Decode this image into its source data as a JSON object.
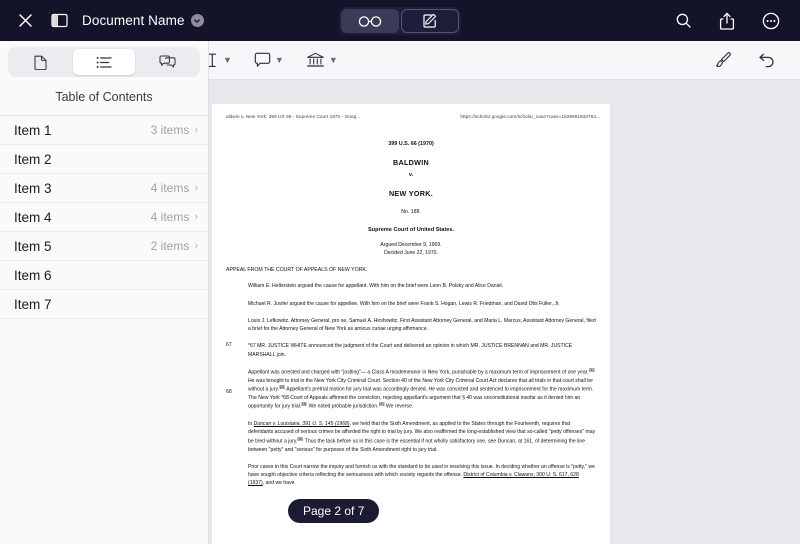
{
  "topbar": {
    "close_icon": "close-x-icon",
    "sidebar_toggle_icon": "sidebar-toggle-icon",
    "title": "Document Name",
    "title_badge_icon": "chevron-down-circle-icon",
    "mode_read_icon": "reading-glasses-icon",
    "mode_markup_icon": "pencil-square-icon",
    "search_icon": "search-icon",
    "share_icon": "share-upload-icon",
    "more_icon": "more-ellipsis-circle-icon"
  },
  "toolbar": {
    "text_tool_icon": "text-cursor-icon",
    "comment_tool_icon": "comment-bubble-icon",
    "bank_tool_icon": "bank-building-icon",
    "brush_icon": "brush-icon",
    "undo_icon": "undo-arrow-icon"
  },
  "sidebar": {
    "tabs": [
      {
        "icon": "page-document-icon",
        "active": false
      },
      {
        "icon": "list-outline-icon",
        "active": true
      },
      {
        "icon": "speech-bubbles-icon",
        "active": false
      }
    ],
    "title": "Table of Contents",
    "items": [
      {
        "label": "Item 1",
        "count": "3 items",
        "arrow": "›"
      },
      {
        "label": "Item 2",
        "count": "",
        "arrow": ""
      },
      {
        "label": "Item 3",
        "count": "4 items",
        "arrow": "›"
      },
      {
        "label": "Item 4",
        "count": "4 items",
        "arrow": "›"
      },
      {
        "label": "Item 5",
        "count": "2 items",
        "arrow": "›"
      },
      {
        "label": "Item 6",
        "count": "",
        "arrow": ""
      },
      {
        "label": "Item 7",
        "count": "",
        "arrow": ""
      }
    ]
  },
  "document": {
    "header_title": "aldwin v. New York, 399 US 66 - Supreme Court 1970 - Goog...",
    "header_url": "https://scholar.google.com/scholar_case?case=1828891833764...",
    "citation": "399 U.S. 66 (1970)",
    "case_name": "BALDWIN",
    "versus": "v.",
    "case_name2": "NEW YORK.",
    "docket": "No. 188.",
    "court": "Supreme Court of United States.",
    "argued": "Argued December 9, 1969.",
    "decided": "Decided June 22, 1970.",
    "appeal_line": "APPEAL FROM THE COURT OF APPEALS OF NEW YORK.",
    "counsel_1": "William E. Hellerstein argued the cause for appellant. With him on the brief were Leon B. Polsky and Alice Daniel.",
    "counsel_2": "Michael R. Juviler argued the cause for appellee. With him on the brief were Frank S. Hogan, Lewis R. Friedman, and David Otis Fuller, Jr.",
    "counsel_3": "Louis J. Lefkowitz, Attorney General, pro se, Samuel A. Hirshowitz, First Assistant Attorney General, and Maria L. Marcus, Assistant Attorney General, filed a brief for the Attorney General of New York as amicus curiae urging affirmance.",
    "margin_67": "67",
    "margin_68": "68",
    "opinion_1": "*67 MR. JUSTICE WHITE announced the judgment of the Court and delivered an opinion in which MR. JUSTICE BRENNAN and MR. JUSTICE MARSHALL join.",
    "opinion_2_a": "Appellant was arrested and charged with \"jostling\"— a Class A misdemeanor in New York, punishable by a maximum term of imprisonment of one year.",
    "opinion_2_b": " He was brought to trial in the New York City Criminal Court. Section 40 of the New York City Criminal Court Act declares that all trials in that court shall be without a jury.",
    "opinion_2_c": " Appellant's pretrial motion for jury trial was accordingly denied. He was convicted and sentenced to imprisonment for the maximum term. The New York *68 Court of Appeals affirmed the conviction, rejecting appellant's argument that § 40 was unconstitutional insofar as it denied him an opportunity for jury trial.",
    "opinion_2_d": " We noted probable jurisdiction.",
    "opinion_2_e": " We reverse.",
    "opinion_3_pre": "In ",
    "opinion_3_link": "Duncan v. Louisiana, 391 U. S. 145 (1968)",
    "opinion_3_a": ", we held that the Sixth Amendment, as applied to the States through the Fourteenth, requires that defendants accused of serious crimes be afforded the right to trial by jury. We also reaffirmed the long-established view that so-called \"petty offenses\" may be tried without a jury.",
    "opinion_3_b": " Thus the task before us in this case is the essential if not wholly satisfactory one, see Duncan, at 161, of determining the line between \"petty\" and \"serious\" for purposes of the Sixth Amendment right to jury trial.",
    "opinion_4_a": "Prior cases in this Court narrow the inquiry and furnish us with the standard to be used in resolving this issue. In deciding whether an offense is \"petty,\" we have sought objective criteria reflecting the seriousness with which society regards the offense. ",
    "opinion_4_link": "District of Columbia v. Clawans, 300 U. S. 617, 628 (1937)",
    "opinion_4_b": ", and we have",
    "footnote_mark": "[1]"
  },
  "page_indicator": {
    "label": "Page 2 of 7"
  },
  "colors": {
    "topbar_bg": "#13142a",
    "toolbar_bg": "#f7f7fa",
    "sidebar_bg": "#fafafa",
    "doc_backdrop": "#e8e8ec",
    "pill_bg": "#1b1c34"
  }
}
